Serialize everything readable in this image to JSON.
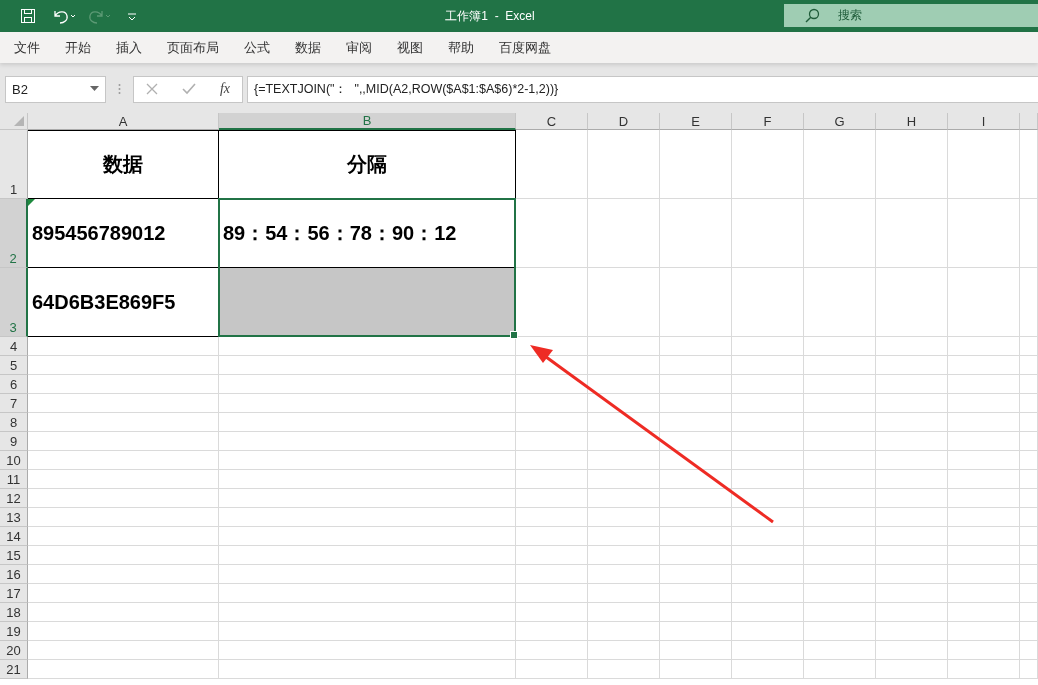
{
  "window": {
    "title": "工作簿1  -  Excel",
    "search_placeholder": "搜索"
  },
  "menu": [
    {
      "label": "文件"
    },
    {
      "label": "开始"
    },
    {
      "label": "插入"
    },
    {
      "label": "页面布局"
    },
    {
      "label": "公式"
    },
    {
      "label": "数据"
    },
    {
      "label": "审阅"
    },
    {
      "label": "视图"
    },
    {
      "label": "帮助"
    },
    {
      "label": "百度网盘"
    }
  ],
  "formula_bar": {
    "name_box": "B2",
    "fx_label": "fx",
    "formula": "{=TEXTJOIN(\"：  \",,MID(A2,ROW($A$1:$A$6)*2-1,2))}"
  },
  "columns": [
    {
      "label": "A",
      "selected": false
    },
    {
      "label": "B",
      "selected": true
    },
    {
      "label": "C",
      "selected": false
    },
    {
      "label": "D",
      "selected": false
    },
    {
      "label": "E",
      "selected": false
    },
    {
      "label": "F",
      "selected": false
    },
    {
      "label": "G",
      "selected": false
    },
    {
      "label": "H",
      "selected": false
    },
    {
      "label": "I",
      "selected": false
    }
  ],
  "rows": [
    {
      "number": "1",
      "selected": false,
      "cells": [
        {
          "kind": "header",
          "text": "数据",
          "error_flag": false,
          "selected": false
        },
        {
          "kind": "header",
          "text": "分隔",
          "error_flag": false,
          "selected": false
        }
      ]
    },
    {
      "number": "2",
      "selected": true,
      "cells": [
        {
          "kind": "value",
          "text": "895456789012",
          "error_flag": true,
          "selected": false
        },
        {
          "kind": "value",
          "text": "89：54：56：78：90：12",
          "error_flag": false,
          "selected": true
        }
      ]
    },
    {
      "number": "3",
      "selected": true,
      "cells": [
        {
          "kind": "value",
          "text": "64D6B3E869F5",
          "error_flag": false,
          "selected": false
        },
        {
          "kind": "value",
          "error_flag": false,
          "selected": true
        }
      ]
    },
    {
      "number": "4",
      "selected": false
    },
    {
      "number": "5",
      "selected": false
    },
    {
      "number": "6",
      "selected": false
    },
    {
      "number": "7",
      "selected": false
    },
    {
      "number": "8",
      "selected": false
    },
    {
      "number": "9",
      "selected": false
    },
    {
      "number": "10",
      "selected": false
    },
    {
      "number": "11",
      "selected": false
    },
    {
      "number": "12",
      "selected": false
    },
    {
      "number": "13",
      "selected": false
    },
    {
      "number": "14",
      "selected": false
    },
    {
      "number": "15",
      "selected": false
    },
    {
      "number": "16",
      "selected": false
    },
    {
      "number": "17",
      "selected": false
    },
    {
      "number": "18",
      "selected": false
    },
    {
      "number": "19",
      "selected": false
    },
    {
      "number": "20",
      "selected": false
    },
    {
      "number": "21",
      "selected": false
    }
  ]
}
